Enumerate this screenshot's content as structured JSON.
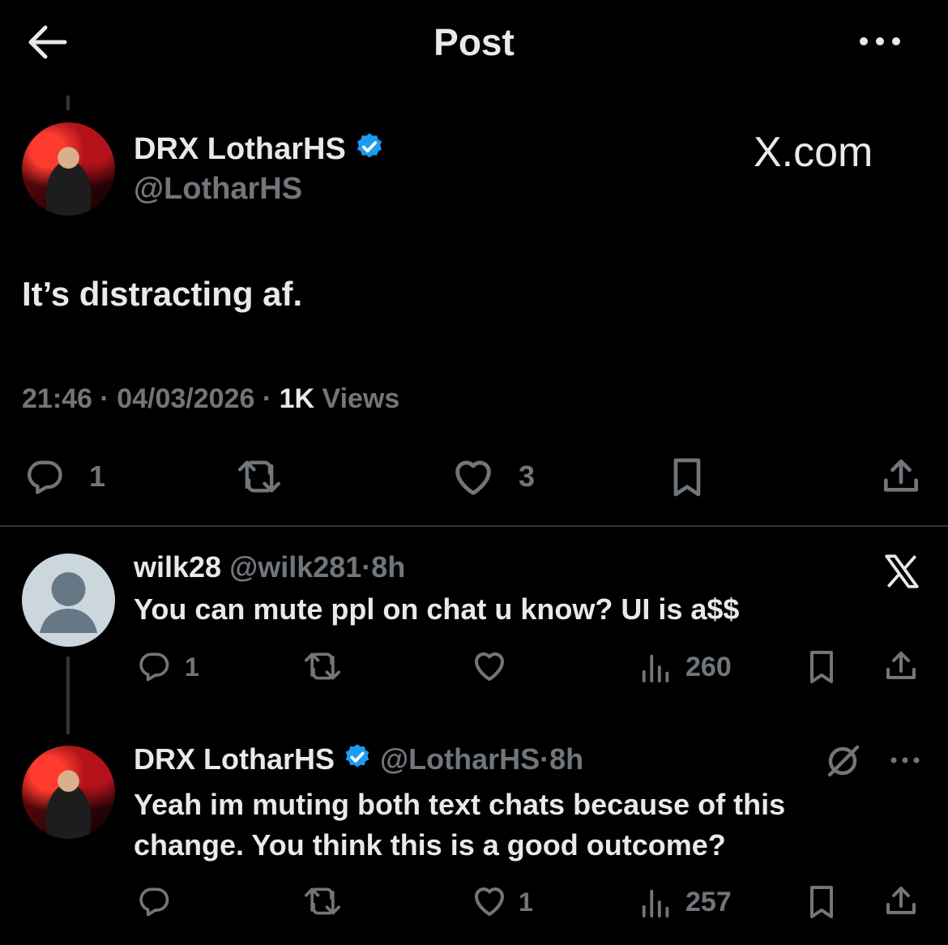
{
  "header": {
    "title": "Post",
    "back_icon": "arrow-left-icon",
    "more_icon": "more-horizontal-icon"
  },
  "main_post": {
    "display_name": "DRX LotharHS",
    "handle": "@LotharHS",
    "watermark": "X.com",
    "text": "It’s distracting af.",
    "time": "21:46",
    "sep1": "·",
    "date": "04/03/2026",
    "sep2": "·",
    "views_count": "1K",
    "views_label": "Views",
    "reply_count": "1",
    "like_count": "3",
    "accent": "#1d9bf0"
  },
  "reply1": {
    "display_name": "wilk28",
    "handle": "@wilk281",
    "sep": "·",
    "age": "8h",
    "text": "You can mute ppl on chat u know? UI is a$$",
    "reply_count": "1",
    "views": "260"
  },
  "reply2": {
    "display_name": "DRX LotharHS",
    "handle": "@LotharHS",
    "sep": "·",
    "age": "8h",
    "text_line1": "Yeah im muting both text chats because of this",
    "text_line2": "change. You think this is a good outcome?",
    "like_count": "1",
    "views": "257"
  }
}
